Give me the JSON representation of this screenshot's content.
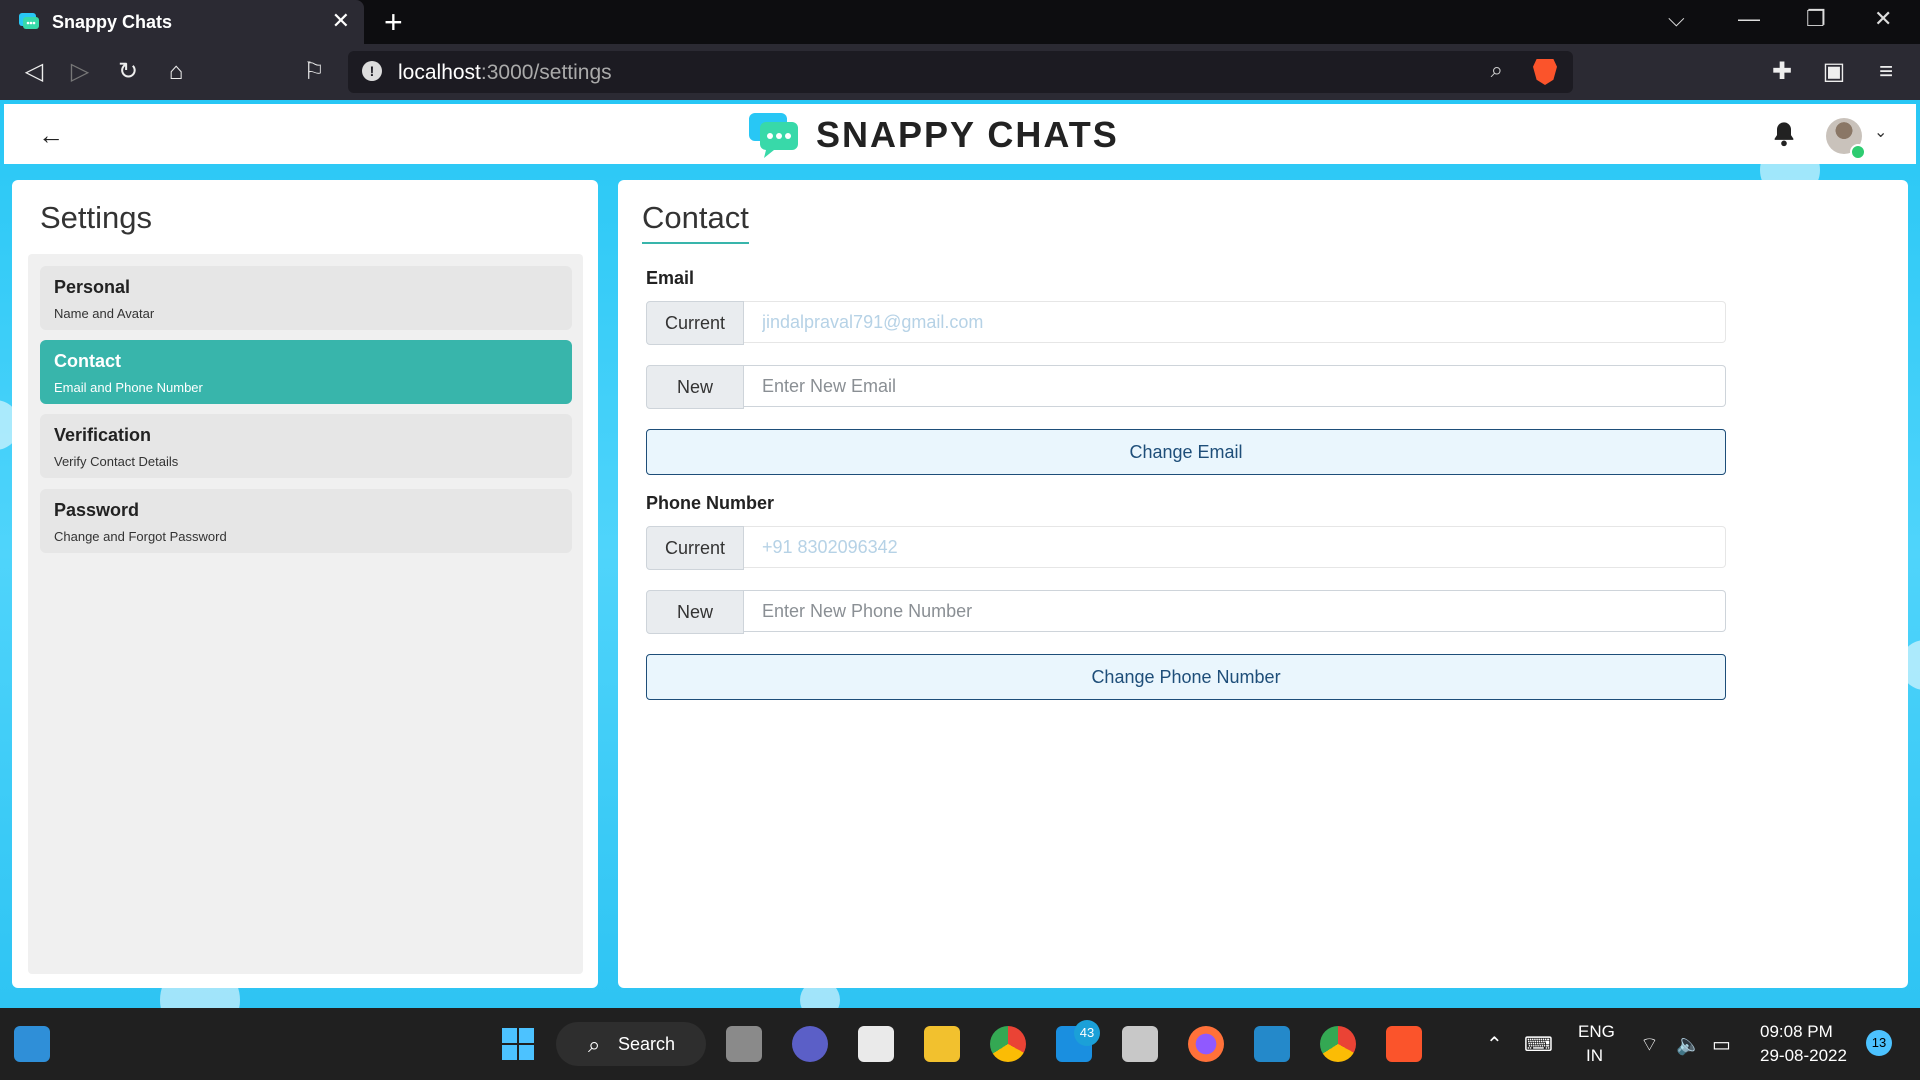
{
  "browser": {
    "tab_title": "Snappy Chats",
    "url_host": "localhost",
    "url_path": ":3000/settings"
  },
  "header": {
    "logo_text": "SNAPPY CHATS"
  },
  "settings": {
    "title": "Settings",
    "menu": [
      {
        "label": "Personal",
        "sub": "Name and Avatar",
        "active": false
      },
      {
        "label": "Contact",
        "sub": "Email and Phone Number",
        "active": true
      },
      {
        "label": "Verification",
        "sub": "Verify Contact Details",
        "active": false
      },
      {
        "label": "Password",
        "sub": "Change and Forgot Password",
        "active": false
      }
    ]
  },
  "contact": {
    "title": "Contact",
    "email_label": "Email",
    "current_prefix": "Current",
    "new_prefix": "New",
    "current_email": "jindalpraval791@gmail.com",
    "new_email_placeholder": "Enter New Email",
    "change_email_button": "Change Email",
    "phone_label": "Phone Number",
    "current_phone": "+91 8302096342",
    "new_phone_placeholder": "Enter New Phone Number",
    "change_phone_button": "Change Phone Number"
  },
  "taskbar": {
    "search_label": "Search",
    "mail_badge": "43",
    "lang_line1": "ENG",
    "lang_line2": "IN",
    "time": "09:08 PM",
    "date": "29-08-2022",
    "notification_count": "13"
  },
  "colors": {
    "accent": "#38b5ab",
    "page_bg": "#28c7f5",
    "button_border": "#1e4e79"
  }
}
